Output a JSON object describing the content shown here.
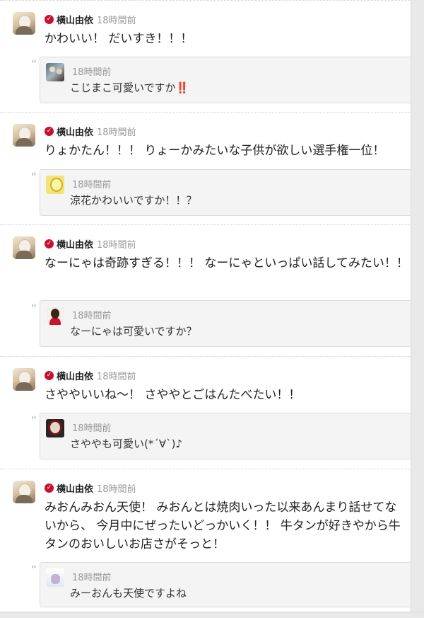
{
  "author": {
    "name": "横山由依",
    "verified_icon": "check-badge-icon",
    "accent": "#c8102e"
  },
  "posts": [
    {
      "time": "18時間前",
      "text": "かわいい！ だいすき！！！",
      "reply": {
        "time": "18時間前",
        "text": "こじまこ可愛いですか",
        "suffix": "‼️"
      }
    },
    {
      "time": "18時間前",
      "text": "りょかたん！！！ りょーかみたいな子供が欲しい選手権一位！",
      "reply": {
        "time": "18時間前",
        "text": "涼花かわいいですか！！？"
      }
    },
    {
      "time": "18時間前",
      "text": "なーにゃは奇跡すぎる！！！ なーにゃといっぱい話してみたい！！",
      "reply": {
        "time": "18時間前",
        "text": "なーにゃは可愛いですか？"
      }
    },
    {
      "time": "18時間前",
      "text": "さややいいね〜！ さややとごはんたべたい！！",
      "reply": {
        "time": "18時間前",
        "text": "さややも可愛い(*´∀`)♪"
      }
    },
    {
      "time": "18時間前",
      "text": "みおんみおん天使！ みおんとは焼肉いった以来あんまり話せてないから、 今月中にぜったいどっかいく！！ 牛タンが好きやから牛タンのおいしいお店さがそっと！",
      "reply": {
        "time": "18時間前",
        "text": "みーおんも天使ですよね"
      }
    }
  ],
  "quote_glyph": "“"
}
